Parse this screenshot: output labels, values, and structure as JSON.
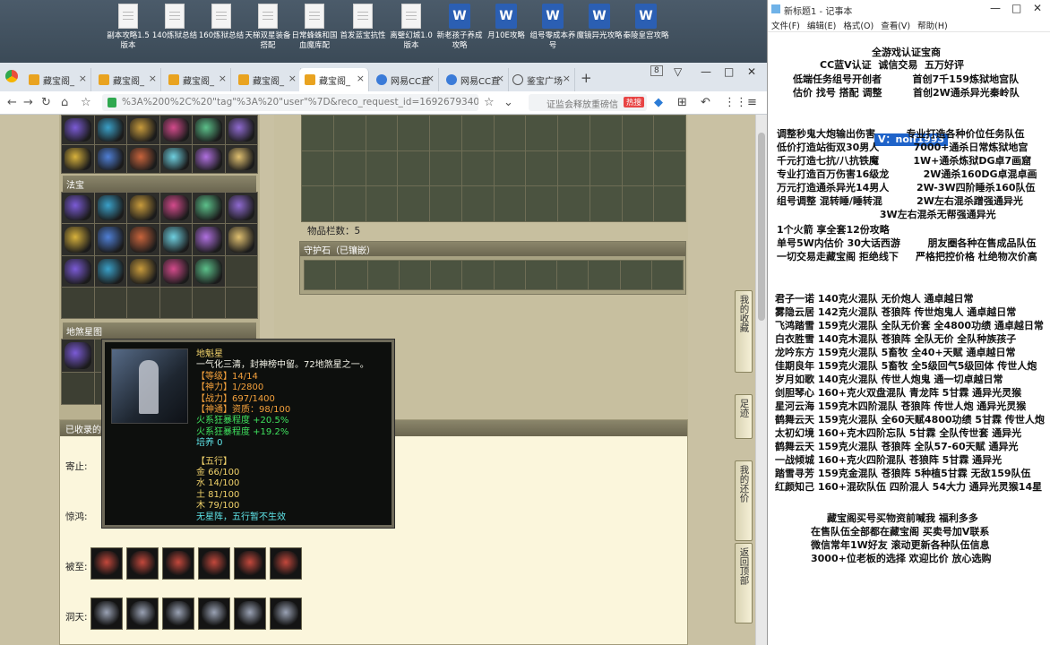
{
  "desktop": {
    "icons": [
      {
        "label": "副本攻略1.5版本",
        "type": "file"
      },
      {
        "label": "140炼狱总结",
        "type": "file"
      },
      {
        "label": "160炼狱总结",
        "type": "file"
      },
      {
        "label": "天梯双星装备搭配",
        "type": "file"
      },
      {
        "label": "日常蜂蛛和国血魔库配",
        "type": "file"
      },
      {
        "label": "首发蓝宝抗性",
        "type": "file"
      },
      {
        "label": "离璧幻城1.0版本",
        "type": "file"
      },
      {
        "label": "新老孩子养成攻略",
        "type": "word"
      },
      {
        "label": "月10E攻略",
        "type": "word"
      },
      {
        "label": "组号零成本养号",
        "type": "word"
      },
      {
        "label": "魔镜异光攻略",
        "type": "word"
      },
      {
        "label": "秦陵皇宫攻略",
        "type": "word"
      }
    ]
  },
  "browser": {
    "tabs": [
      {
        "label": "藏宝阁_",
        "icon": "treasure-icon"
      },
      {
        "label": "藏宝阁_",
        "icon": "treasure-icon"
      },
      {
        "label": "藏宝阁_",
        "icon": "treasure-icon"
      },
      {
        "label": "藏宝阁_",
        "icon": "treasure-icon"
      },
      {
        "label": "藏宝阁_",
        "icon": "treasure-icon",
        "active": true
      },
      {
        "label": "网易CC直",
        "icon": "cc-icon"
      },
      {
        "label": "网易CC直",
        "icon": "cc-icon"
      },
      {
        "label": "鉴宝广场",
        "icon": "globe-icon"
      }
    ],
    "url": "%3A%200%2C%20\"tag\"%3A%20\"user\"%7D&reco_request_id=16926793400719DMaF",
    "search_placeholder": "证监会释放重磅信",
    "search_badge": "热搜",
    "tab_count": "8"
  },
  "page": {
    "sections": {
      "fabao": "法宝",
      "disha": "地煞星图",
      "collected": "已收录的",
      "guardstone": "守护石（已镶嵌）"
    },
    "item_count_label": "物品栏数：5",
    "rows": [
      "寄止:",
      "惊鸿:",
      "被至:",
      "洞天:"
    ],
    "side_buttons": [
      "我的收藏",
      "足迹",
      "我的还价",
      "返回顶部"
    ]
  },
  "tooltip": {
    "name": "地魁星",
    "desc": "一气化三清，封神榜中留。72地煞星之一。",
    "level": "【等级】14/14",
    "shenli": "【神力】1/2800",
    "zhanli": "【战力】697/1400",
    "zizhi": "【神通】资质：98/100",
    "fire1": "火系狂暴程度 +20.5%",
    "fire2": "火系狂暴程度 +19.2%",
    "peiyang": "培养 0",
    "wuxing_title": "【五行】",
    "jin": "金 66/100",
    "shui": "水 14/100",
    "tu": "土 81/100",
    "mu": "木 79/100",
    "note": "无星阵，五行暂不生效"
  },
  "notepad": {
    "title": "新标题1 - 记事本",
    "menu": [
      "文件(F)",
      "编辑(E)",
      "格式(O)",
      "查看(V)",
      "帮助(H)"
    ],
    "badge": "V：noif1993",
    "lines": [
      "全游戏认证宝商",
      "CC蓝V认证  诚信交易  五万好评",
      "低端任务组号开创者         首创7千159炼狱地宫队",
      "估价 找号 搭配 调整         首创2W通杀异光秦岭队",
      "调整秒鬼大炮输出伤害         专业打造各种价位任务队伍",
      "低价打造站街双30男人          7000+通杀日常炼狱地宫",
      "千元打造七抗/八抗铁魔          1W+通杀炼狱DG卓7画窟",
      "专业打造百万伤害16级龙          2W通杀160DG卓混卓画",
      "万元打造通杀异光14男人        2W-3W四阶睡杀160队伍",
      "组号调整 混转睡/睡转混          2W左右混杀蹭强通异光",
      "                              3W左右混杀无帮强通异光",
      "1个火箭 享全套12份攻略",
      "单号5W内估价 30大话西游        朋友圈各种在售成品队伍",
      "一切交易走藏宝阁 拒绝线下     严格把控价格 杜绝物次价高",
      "君子一诺 140克火混队 无价炮人 通卓越日常",
      "雾隐云居 142克火混队 苍狼阵 传世炮鬼人 通卓越日常",
      "飞鸿踏雪 159克火混队 全队无价套 全4800功绩 通卓越日常",
      "白衣胜雪 140克木混队 苍狼阵 全队无价 全队种族孩子",
      "龙吟东方 159克火混队 5畜牧 全40+天赋 通卓越日常",
      "佳期良年 159克火混队 5畜牧 全5级回气5级回体 传世人炮",
      "岁月如歌 140克火混队 传世人炮鬼 通一切卓越日常",
      "剑胆琴心 160+克火双盘混队 青龙阵 5甘霖 通异光灵猴",
      "星河云海 159克木四阶混队 苍狼阵 传世人炮 通异光灵猴",
      "鹤舞云天 159克火混队 全60天赋4800功绩 5甘霖 传世人炮",
      "太初幻境 160+克木四阶忘队 5甘霖 全队传世套 通异光",
      "鹤舞云天 159克火混队 苍狼阵 全队57-60天赋 通异光",
      "一战倾城 160+克火四阶混队 苍狼阵 5甘霖 通异光",
      "踏雪寻芳 159克金混队 苍狼阵 5种植5甘霖 无敌159队伍",
      "红颜知己 160+混砍队伍 四阶混人 54大力 通异光灵猴14星",
      "藏宝阁买号买物资前喊我 福利多多",
      "在售队伍全部都在藏宝阁 买卖号加V联系",
      "微信常年1W好友 滚动更新各种队伍信息",
      "3000+位老板的选择 欢迎比价 放心选购"
    ]
  }
}
